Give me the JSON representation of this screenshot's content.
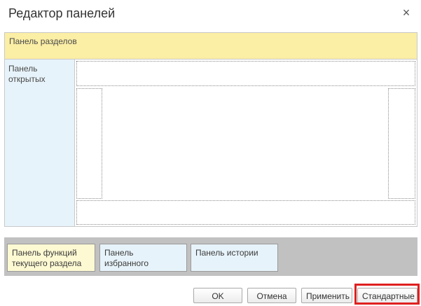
{
  "dialog": {
    "title": "Редактор панелей",
    "close_icon": "close-icon",
    "close_glyph": "×"
  },
  "layout_panels": {
    "sections": {
      "label": "Панель разделов",
      "color": "#fbeea5"
    },
    "open": {
      "label": "Панель открытых",
      "color": "#e7f3fa"
    }
  },
  "available_panels": [
    {
      "label": "Панель функций текущего раздела",
      "color": "#fdf9d2"
    },
    {
      "label": "Панель избранного",
      "color": "#e7f3fa"
    },
    {
      "label": "Панель истории",
      "color": "#e7f3fa"
    }
  ],
  "buttons": {
    "ok": "OK",
    "cancel": "Отмена",
    "apply": "Применить",
    "standard": "Стандартные"
  },
  "highlight_color": "#e02020"
}
